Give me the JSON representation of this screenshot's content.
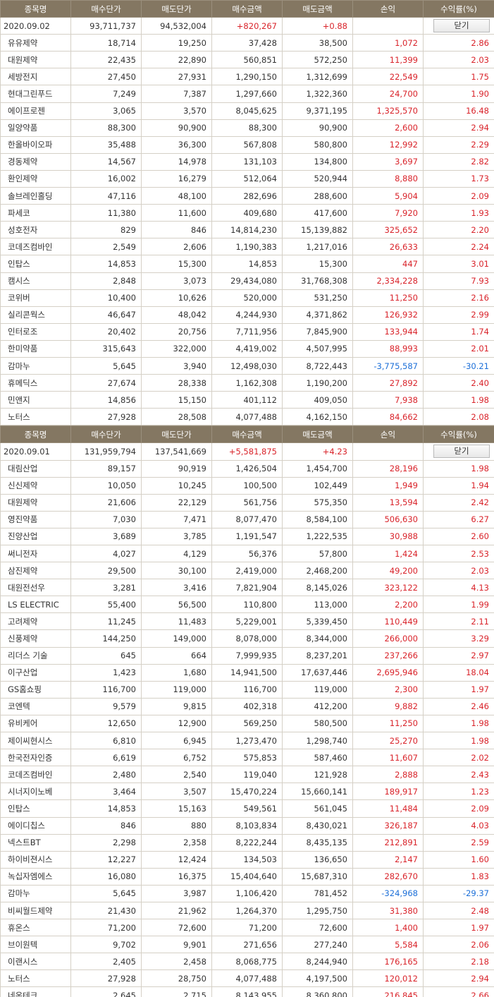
{
  "columns": [
    "종목명",
    "매수단가",
    "매도단가",
    "매수금액",
    "매도금액",
    "손익",
    "수익률(%)"
  ],
  "close_label": "닫기",
  "sections": [
    {
      "date": "2020.09.02",
      "total_buy": "93,711,737",
      "total_sell": "94,532,004",
      "profit": "+820,267",
      "rate": "+0.88",
      "rows": [
        [
          "유유제약",
          "18,714",
          "19,250",
          "37,428",
          "38,500",
          "1,072",
          "2.86"
        ],
        [
          "대원제약",
          "22,435",
          "22,890",
          "560,851",
          "572,250",
          "11,399",
          "2.03"
        ],
        [
          "세방전지",
          "27,450",
          "27,931",
          "1,290,150",
          "1,312,699",
          "22,549",
          "1.75"
        ],
        [
          "현대그린푸드",
          "7,249",
          "7,387",
          "1,297,660",
          "1,322,360",
          "24,700",
          "1.90"
        ],
        [
          "에이프로젠",
          "3,065",
          "3,570",
          "8,045,625",
          "9,371,195",
          "1,325,570",
          "16.48"
        ],
        [
          "일양약품",
          "88,300",
          "90,900",
          "88,300",
          "90,900",
          "2,600",
          "2.94"
        ],
        [
          "한올바이오파",
          "35,488",
          "36,300",
          "567,808",
          "580,800",
          "12,992",
          "2.29"
        ],
        [
          "경동제약",
          "14,567",
          "14,978",
          "131,103",
          "134,800",
          "3,697",
          "2.82"
        ],
        [
          "환인제약",
          "16,002",
          "16,279",
          "512,064",
          "520,944",
          "8,880",
          "1.73"
        ],
        [
          "솔브레인홀딩",
          "47,116",
          "48,100",
          "282,696",
          "288,600",
          "5,904",
          "2.09"
        ],
        [
          "파세코",
          "11,380",
          "11,600",
          "409,680",
          "417,600",
          "7,920",
          "1.93"
        ],
        [
          "성호전자",
          "829",
          "846",
          "14,814,230",
          "15,139,882",
          "325,652",
          "2.20"
        ],
        [
          "코데즈컴바인",
          "2,549",
          "2,606",
          "1,190,383",
          "1,217,016",
          "26,633",
          "2.24"
        ],
        [
          "인탑스",
          "14,853",
          "15,300",
          "14,853",
          "15,300",
          "447",
          "3.01"
        ],
        [
          "캠시스",
          "2,848",
          "3,073",
          "29,434,080",
          "31,768,308",
          "2,334,228",
          "7.93"
        ],
        [
          "코위버",
          "10,400",
          "10,626",
          "520,000",
          "531,250",
          "11,250",
          "2.16"
        ],
        [
          "실리콘웍스",
          "46,647",
          "48,042",
          "4,244,930",
          "4,371,862",
          "126,932",
          "2.99"
        ],
        [
          "인터로조",
          "20,402",
          "20,756",
          "7,711,956",
          "7,845,900",
          "133,944",
          "1.74"
        ],
        [
          "한미약품",
          "315,643",
          "322,000",
          "4,419,002",
          "4,507,995",
          "88,993",
          "2.01"
        ],
        [
          "감마누",
          "5,645",
          "3,940",
          "12,498,030",
          "8,722,443",
          "-3,775,587",
          "-30.21"
        ],
        [
          "휴메딕스",
          "27,674",
          "28,338",
          "1,162,308",
          "1,190,200",
          "27,892",
          "2.40"
        ],
        [
          "민앤지",
          "14,856",
          "15,150",
          "401,112",
          "409,050",
          "7,938",
          "1.98"
        ],
        [
          "노터스",
          "27,928",
          "28,508",
          "4,077,488",
          "4,162,150",
          "84,662",
          "2.08"
        ]
      ]
    },
    {
      "date": "2020.09.01",
      "total_buy": "131,959,794",
      "total_sell": "137,541,669",
      "profit": "+5,581,875",
      "rate": "+4.23",
      "rows": [
        [
          "대림산업",
          "89,157",
          "90,919",
          "1,426,504",
          "1,454,700",
          "28,196",
          "1.98"
        ],
        [
          "신신제약",
          "10,050",
          "10,245",
          "100,500",
          "102,449",
          "1,949",
          "1.94"
        ],
        [
          "대원제약",
          "21,606",
          "22,129",
          "561,756",
          "575,350",
          "13,594",
          "2.42"
        ],
        [
          "영진약품",
          "7,030",
          "7,471",
          "8,077,470",
          "8,584,100",
          "506,630",
          "6.27"
        ],
        [
          "진양산업",
          "3,689",
          "3,785",
          "1,191,547",
          "1,222,535",
          "30,988",
          "2.60"
        ],
        [
          "써니전자",
          "4,027",
          "4,129",
          "56,376",
          "57,800",
          "1,424",
          "2.53"
        ],
        [
          "삼진제약",
          "29,500",
          "30,100",
          "2,419,000",
          "2,468,200",
          "49,200",
          "2.03"
        ],
        [
          "대원전선우",
          "3,281",
          "3,416",
          "7,821,904",
          "8,145,026",
          "323,122",
          "4.13"
        ],
        [
          "LS ELECTRIC",
          "55,400",
          "56,500",
          "110,800",
          "113,000",
          "2,200",
          "1.99"
        ],
        [
          "고려제약",
          "11,245",
          "11,483",
          "5,229,001",
          "5,339,450",
          "110,449",
          "2.11"
        ],
        [
          "신풍제약",
          "144,250",
          "149,000",
          "8,078,000",
          "8,344,000",
          "266,000",
          "3.29"
        ],
        [
          "리더스 기술",
          "645",
          "664",
          "7,999,935",
          "8,237,201",
          "237,266",
          "2.97"
        ],
        [
          "이구산업",
          "1,423",
          "1,680",
          "14,941,500",
          "17,637,446",
          "2,695,946",
          "18.04"
        ],
        [
          "GS홈쇼핑",
          "116,700",
          "119,000",
          "116,700",
          "119,000",
          "2,300",
          "1.97"
        ],
        [
          "코엔텍",
          "9,579",
          "9,815",
          "402,318",
          "412,200",
          "9,882",
          "2.46"
        ],
        [
          "유비케어",
          "12,650",
          "12,900",
          "569,250",
          "580,500",
          "11,250",
          "1.98"
        ],
        [
          "제이씨현시스",
          "6,810",
          "6,945",
          "1,273,470",
          "1,298,740",
          "25,270",
          "1.98"
        ],
        [
          "한국전자인증",
          "6,619",
          "6,752",
          "575,853",
          "587,460",
          "11,607",
          "2.02"
        ],
        [
          "코데즈컴바인",
          "2,480",
          "2,540",
          "119,040",
          "121,928",
          "2,888",
          "2.43"
        ],
        [
          "시너지이노베",
          "3,464",
          "3,507",
          "15,470,224",
          "15,660,141",
          "189,917",
          "1.23"
        ],
        [
          "인탑스",
          "14,853",
          "15,163",
          "549,561",
          "561,045",
          "11,484",
          "2.09"
        ],
        [
          "에이디칩스",
          "846",
          "880",
          "8,103,834",
          "8,430,021",
          "326,187",
          "4.03"
        ],
        [
          "넥스트BT",
          "2,298",
          "2,358",
          "8,222,244",
          "8,435,135",
          "212,891",
          "2.59"
        ],
        [
          "하이비젼시스",
          "12,227",
          "12,424",
          "134,503",
          "136,650",
          "2,147",
          "1.60"
        ],
        [
          "녹십자엠에스",
          "16,080",
          "16,375",
          "15,404,640",
          "15,687,310",
          "282,670",
          "1.83"
        ],
        [
          "감마누",
          "5,645",
          "3,987",
          "1,106,420",
          "781,452",
          "-324,968",
          "-29.37"
        ],
        [
          "비씨월드제약",
          "21,430",
          "21,962",
          "1,264,370",
          "1,295,750",
          "31,380",
          "2.48"
        ],
        [
          "휴온스",
          "71,200",
          "72,600",
          "71,200",
          "72,600",
          "1,400",
          "1.97"
        ],
        [
          "브이원텍",
          "9,702",
          "9,901",
          "271,656",
          "277,240",
          "5,584",
          "2.06"
        ],
        [
          "이랜시스",
          "2,405",
          "2,458",
          "8,068,775",
          "8,244,940",
          "176,165",
          "2.18"
        ],
        [
          "노터스",
          "27,928",
          "28,750",
          "4,077,488",
          "4,197,500",
          "120,012",
          "2.94"
        ],
        [
          "네온테크",
          "2,645",
          "2,715",
          "8,143,955",
          "8,360,800",
          "216,845",
          "2.66"
        ]
      ]
    }
  ]
}
